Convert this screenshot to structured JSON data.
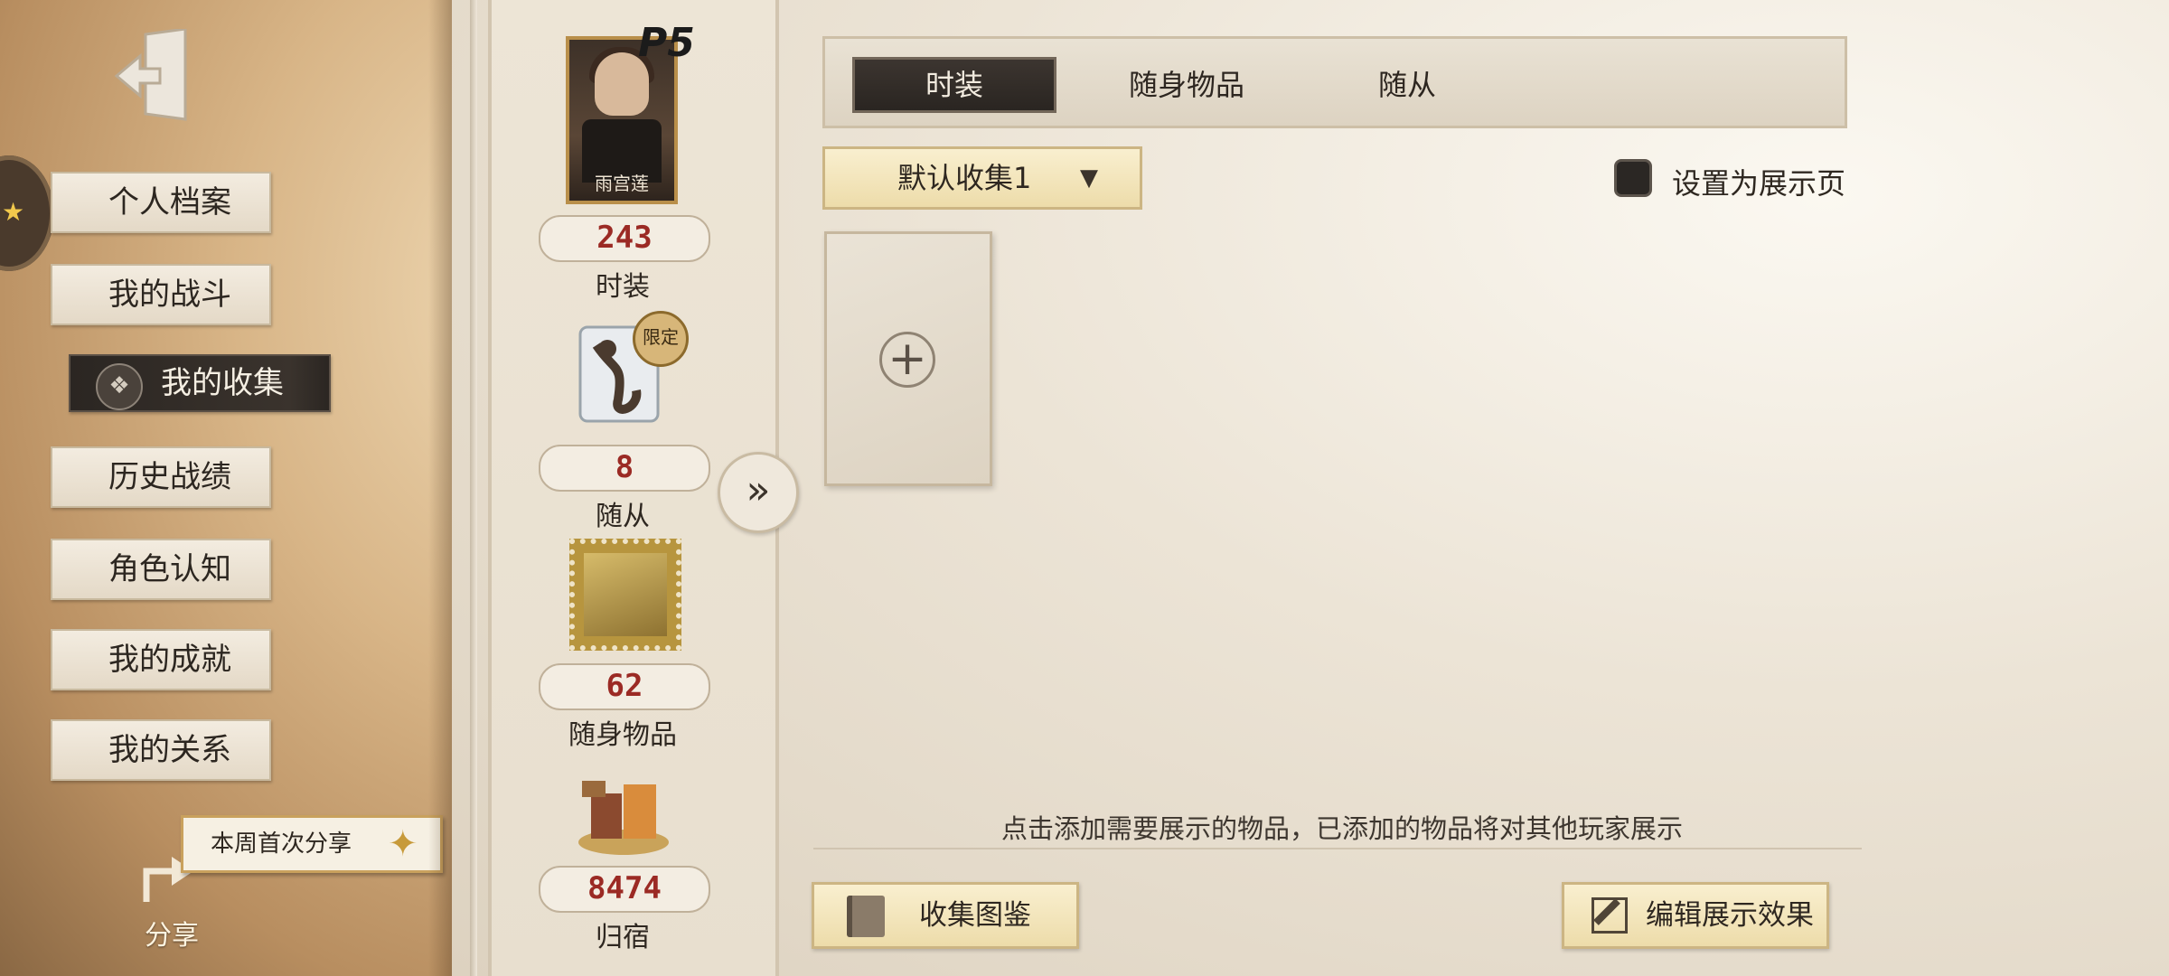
{
  "sidebar": {
    "items": [
      {
        "label": "个人档案"
      },
      {
        "label": "我的战斗"
      },
      {
        "label": "我的收集"
      },
      {
        "label": "历史战绩"
      },
      {
        "label": "角色认知"
      },
      {
        "label": "我的成就"
      },
      {
        "label": "我的关系"
      }
    ],
    "active_index": 2,
    "share_badge": "本周首次分享",
    "share_label": "分享"
  },
  "stats": {
    "card_name": "雨宫莲",
    "logo": "P5",
    "limited_tag": "限定",
    "items": [
      {
        "value": "243",
        "label": "时装"
      },
      {
        "value": "8",
        "label": "随从"
      },
      {
        "value": "62",
        "label": "随身物品"
      },
      {
        "value": "8474",
        "label": "归宿"
      }
    ]
  },
  "tabs": [
    {
      "label": "时装",
      "active": true
    },
    {
      "label": "随身物品",
      "active": false
    },
    {
      "label": "随从",
      "active": false
    }
  ],
  "collection": {
    "dropdown_value": "默认收集1",
    "showcase_label": "设置为展示页",
    "add_symbol": "+",
    "hint": "点击添加需要展示的物品，已添加的物品将对其他玩家展示"
  },
  "buttons": {
    "catalog": "收集图鉴",
    "edit": "编辑展示效果"
  },
  "icons": {
    "arrow": "»"
  },
  "colors": {
    "count_red": "#9b2a24",
    "tab_active": "#2a2521",
    "button_gold": "#eddcaa"
  }
}
